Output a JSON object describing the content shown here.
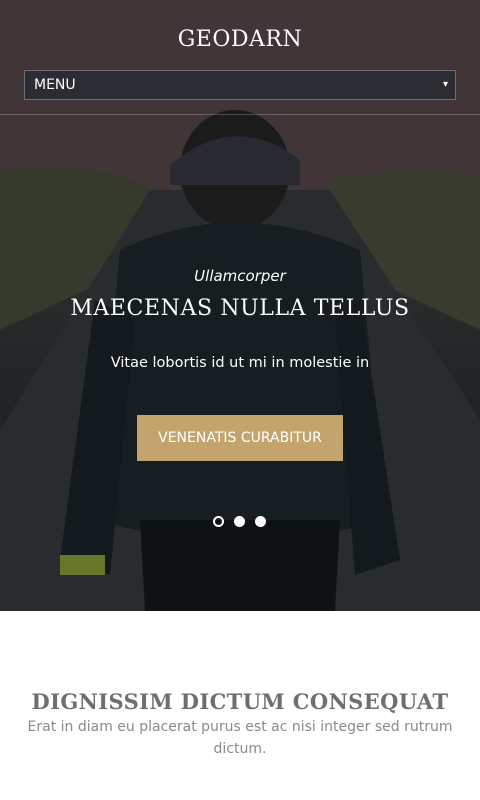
{
  "header": {
    "site_title": "GEODARN",
    "menu_label": "MENU",
    "menu_arrow": "▾"
  },
  "hero": {
    "eyebrow": "Ullamcorper",
    "heading": "MAECENAS NULLA TELLUS",
    "description": "Vitae lobortis id ut mi in molestie in",
    "button_label": "VENENATIS CURABITUR",
    "accent_color": "#c3a46c",
    "slide_count": 3,
    "active_slide": 1
  },
  "intro": {
    "heading": "DIGNISSIM DICTUM CONSEQUAT",
    "text": "Erat in diam eu placerat purus est ac nisi integer sed rutrum dictum."
  }
}
